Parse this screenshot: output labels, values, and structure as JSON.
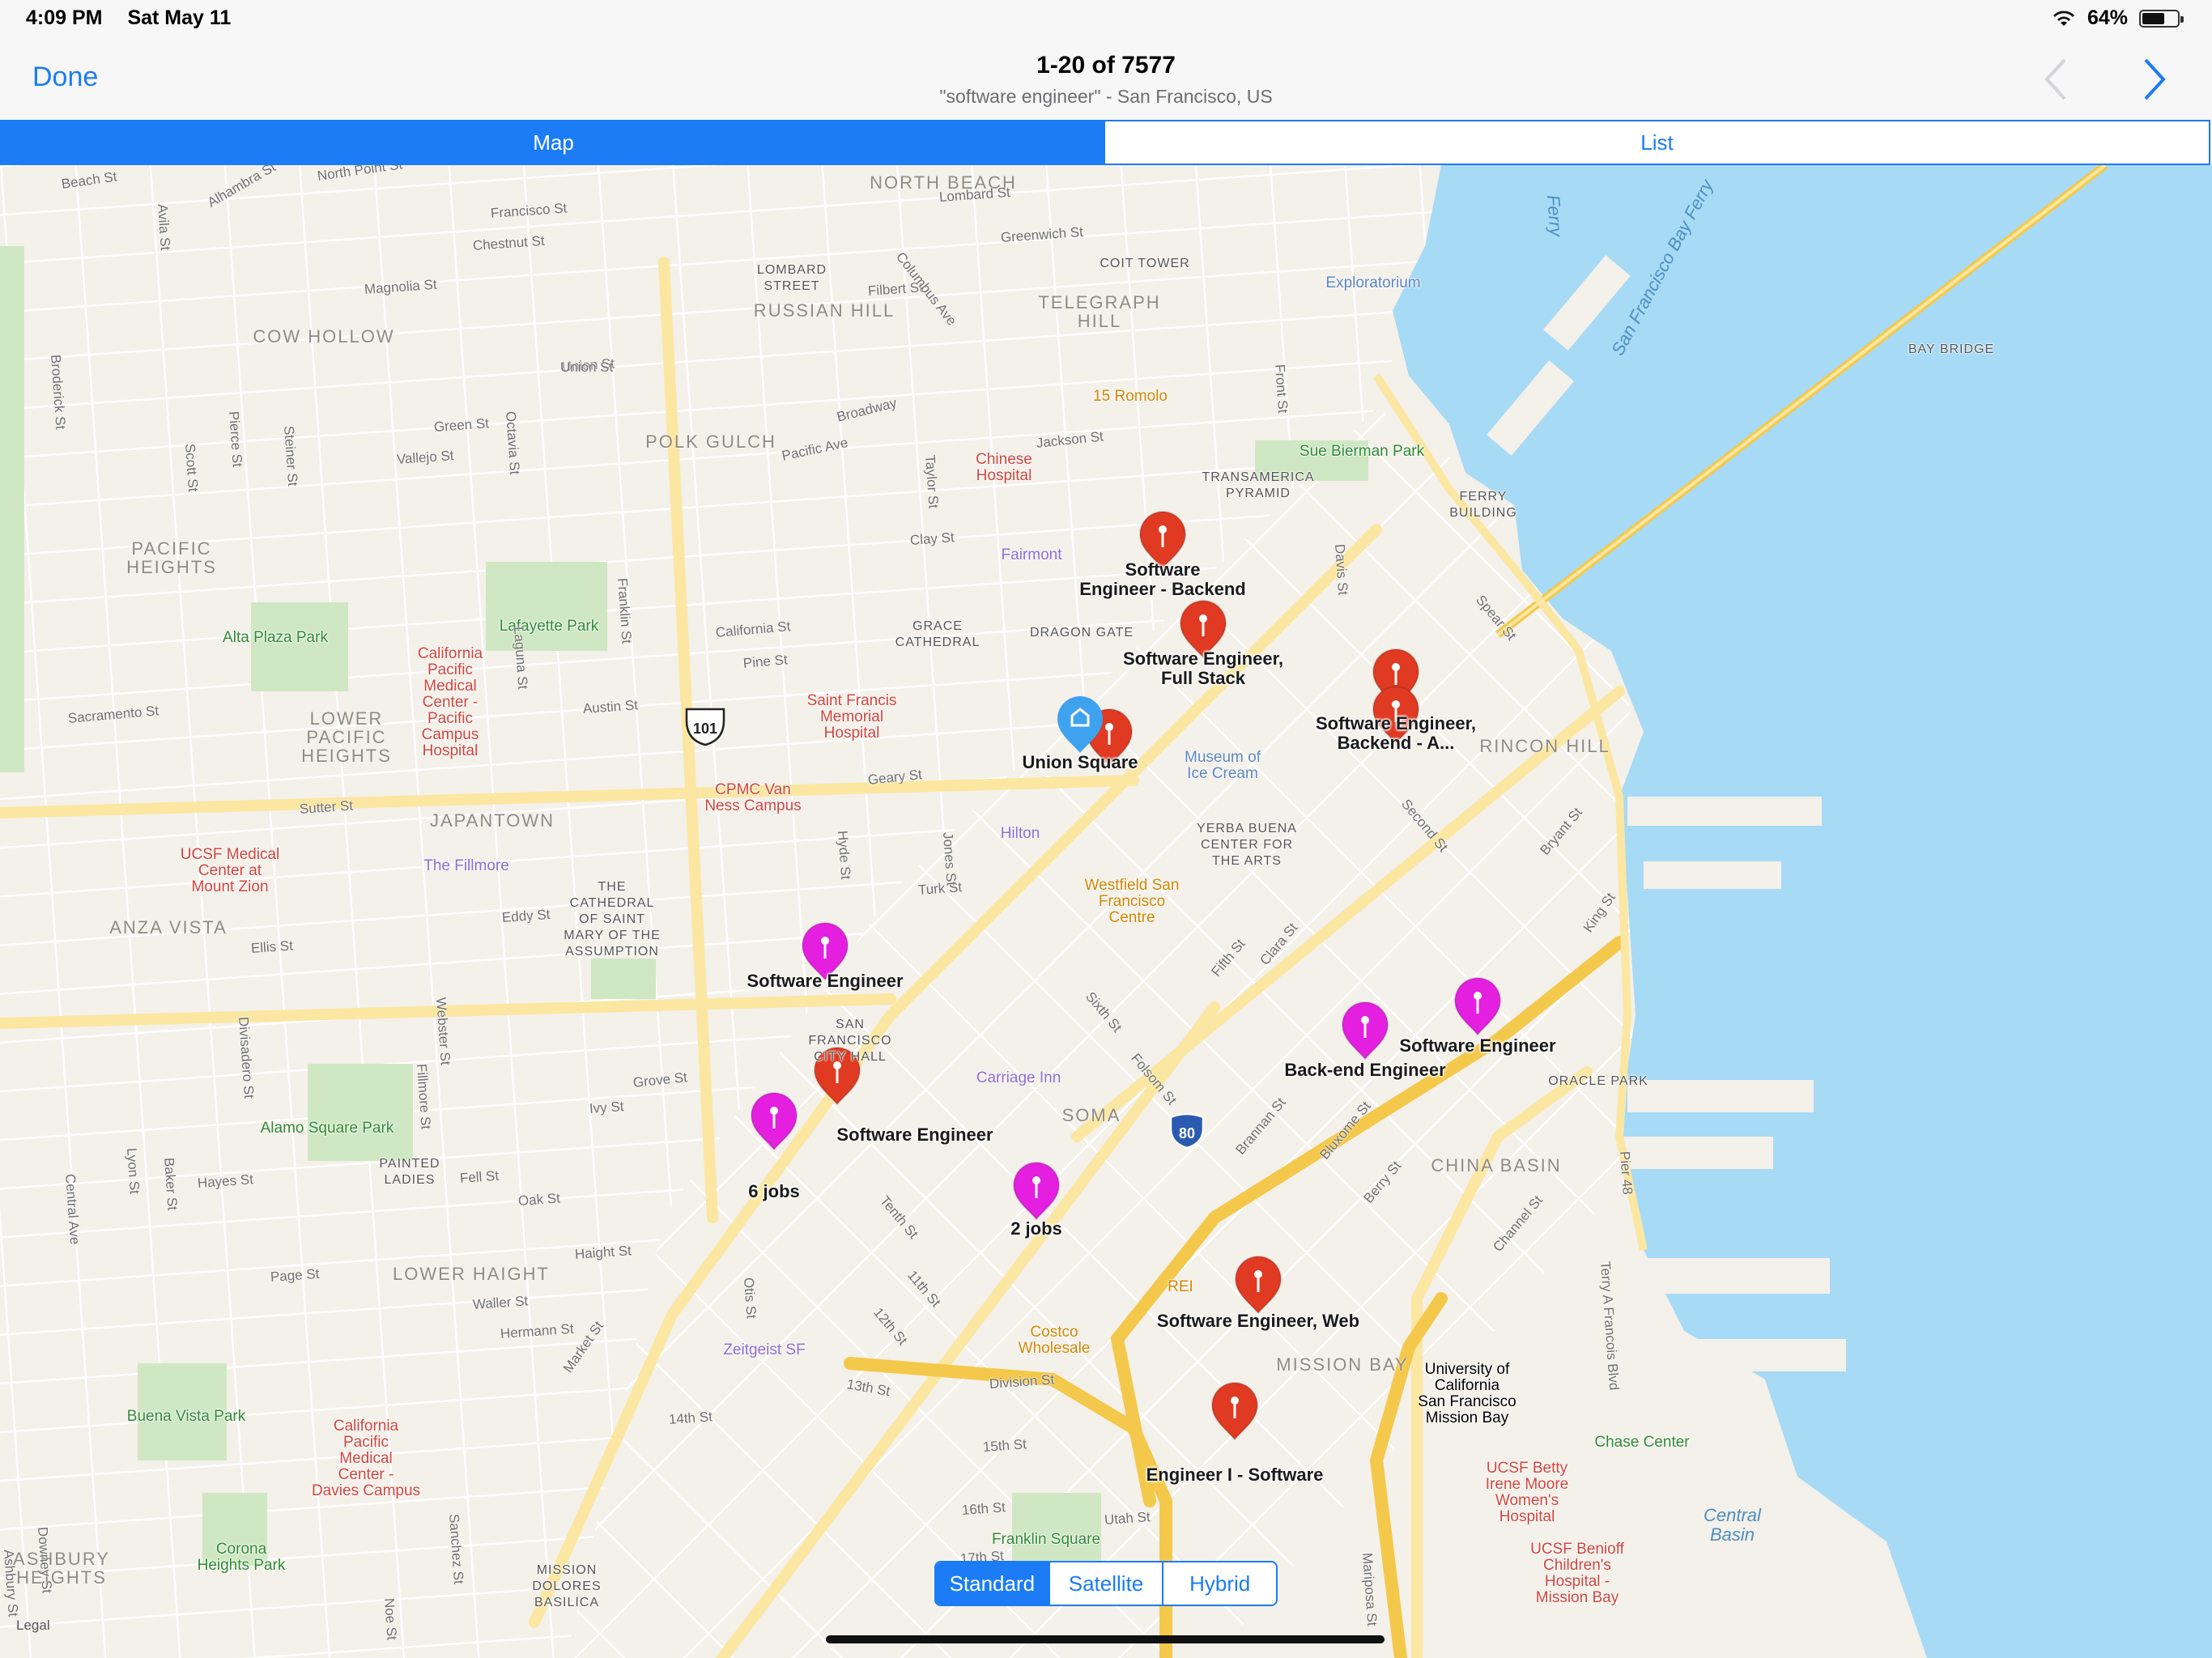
{
  "status": {
    "time": "4:09 PM",
    "date": "Sat May 11",
    "battery": "64%",
    "battery_level": 0.64
  },
  "nav": {
    "done_label": "Done",
    "title": "1-20 of 7577",
    "subtitle": "\"software engineer\" - San Francisco, US"
  },
  "tabs": [
    {
      "label": "Map",
      "active": true
    },
    {
      "label": "List",
      "active": false
    }
  ],
  "map_type": [
    {
      "label": "Standard",
      "active": true
    },
    {
      "label": "Satellite",
      "active": false
    },
    {
      "label": "Hybrid",
      "active": false
    }
  ],
  "legal": "Legal",
  "colors": {
    "accent": "#1b7cf5",
    "pin_red": "#e03a22",
    "pin_magenta": "#e41fe0",
    "water": "#a7daf5",
    "park": "#cfe8c3",
    "road": "#fbe7a1",
    "freeway": "#f4c94b"
  },
  "pins": [
    {
      "color": "red",
      "label": "Software\nEngineer - Backend"
    },
    {
      "color": "red",
      "label": "Software Engineer,\nFull Stack"
    },
    {
      "color": "red",
      "label": ""
    },
    {
      "color": "red",
      "label": "Software Engineer,\nBackend - A..."
    },
    {
      "color": "red",
      "label": ""
    },
    {
      "color": "magenta",
      "label": "Software Engineer"
    },
    {
      "color": "red",
      "label": "Software Engineer"
    },
    {
      "color": "magenta",
      "label": "6 jobs"
    },
    {
      "color": "magenta",
      "label": "2 jobs"
    },
    {
      "color": "magenta",
      "label": "Back-end Engineer"
    },
    {
      "color": "magenta",
      "label": "Software Engineer"
    },
    {
      "color": "red",
      "label": "Software Engineer, Web"
    },
    {
      "color": "red",
      "label": "Engineer I - Software"
    }
  ],
  "user_location_label": "Union Square",
  "districts": [
    "NORTH BEACH",
    "RUSSIAN HILL",
    "TELEGRAPH\nHILL",
    "COW HOLLOW",
    "POLK GULCH",
    "PACIFIC\nHEIGHTS",
    "LOWER\nPACIFIC\nHEIGHTS",
    "JAPANTOWN",
    "ANZA VISTA",
    "RINCON HILL",
    "SOMA",
    "CHINA BASIN",
    "MISSION BAY",
    "LOWER HAIGHT",
    "ASHBURY\nHEIGHTS"
  ],
  "pois": [
    {
      "name": "Lafayette Park",
      "kind": "green"
    },
    {
      "name": "Alta Plaza Park",
      "kind": "green"
    },
    {
      "name": "Alamo Square Park",
      "kind": "green"
    },
    {
      "name": "Buena Vista Park",
      "kind": "green"
    },
    {
      "name": "Corona\nHeights Park",
      "kind": "green"
    },
    {
      "name": "Franklin Square",
      "kind": "green"
    },
    {
      "name": "Sue Bierman Park",
      "kind": "green"
    },
    {
      "name": "Chase Center",
      "kind": "green"
    },
    {
      "name": "California\nPacific\nMedical\nCenter -\nPacific\nCampus\nHospital",
      "kind": "red"
    },
    {
      "name": "Chinese\nHospital",
      "kind": "red"
    },
    {
      "name": "Saint Francis\nMemorial\nHospital",
      "kind": "red"
    },
    {
      "name": "CPMC Van\nNess Campus",
      "kind": "red"
    },
    {
      "name": "UCSF Medical\nCenter at\nMount Zion",
      "kind": "red"
    },
    {
      "name": "California\nPacific\nMedical\nCenter -\nDavies Campus",
      "kind": "red"
    },
    {
      "name": "UCSF Betty\nIrene Moore\nWomen's\nHospital",
      "kind": "red"
    },
    {
      "name": "UCSF Benioff\nChildren's\nHospital -\nMission Bay",
      "kind": "red"
    },
    {
      "name": "15 Romolo",
      "kind": "orange"
    },
    {
      "name": "Westfield San\nFrancisco\nCentre",
      "kind": "orange"
    },
    {
      "name": "Costco\nWholesale",
      "kind": "orange"
    },
    {
      "name": "REI",
      "kind": "orange"
    },
    {
      "name": "Fairmont",
      "kind": "purple"
    },
    {
      "name": "Hilton",
      "kind": "purple"
    },
    {
      "name": "Carriage Inn",
      "kind": "purple"
    },
    {
      "name": "The Fillmore",
      "kind": "purple"
    },
    {
      "name": "Zeitgeist SF",
      "kind": "purple"
    },
    {
      "name": "Museum of\nIce Cream",
      "kind": "blue"
    },
    {
      "name": "Exploratorium",
      "kind": "blue"
    },
    {
      "name": "University of\nCalifornia\nSan Francisco\nMission Bay",
      "kind": "brown"
    },
    {
      "name": "LOMBARD\nSTREET",
      "kind": "dark"
    },
    {
      "name": "COIT TOWER",
      "kind": "dark"
    },
    {
      "name": "TRANSAMERICA\nPYRAMID",
      "kind": "dark"
    },
    {
      "name": "FERRY\nBUILDING",
      "kind": "dark"
    },
    {
      "name": "BAY BRIDGE",
      "kind": "dark"
    },
    {
      "name": "GRACE\nCATHEDRAL",
      "kind": "dark"
    },
    {
      "name": "DRAGON GATE",
      "kind": "dark"
    },
    {
      "name": "YERBA BUENA\nCENTER FOR\nTHE ARTS",
      "kind": "dark"
    },
    {
      "name": "THE\nCATHEDRAL\nOF SAINT\nMARY OF THE\nASSUMPTION",
      "kind": "dark"
    },
    {
      "name": "SAN\nFRANCISCO\nCITY HALL",
      "kind": "dark"
    },
    {
      "name": "PAINTED\nLADIES",
      "kind": "dark"
    },
    {
      "name": "ORACLE PARK",
      "kind": "dark"
    },
    {
      "name": "MISSION\nDOLORES\nBASILICA",
      "kind": "dark"
    }
  ],
  "streets": [
    "Beach St",
    "North Point St",
    "Francisco St",
    "Chestnut St",
    "Lombard St",
    "Greenwich St",
    "Filbert St",
    "Union St",
    "Green St",
    "Vallejo St",
    "Broadway",
    "Pacific Ave",
    "Jackson St",
    "Clay St",
    "California St",
    "Pine St",
    "Sacramento St",
    "Austin St",
    "Sutter St",
    "Geary St",
    "Eddy St",
    "Turk St",
    "Ellis St",
    "Grove St",
    "Ivy St",
    "Hayes St",
    "Fell St",
    "Oak St",
    "Page St",
    "Haight St",
    "Waller St",
    "Hermann St",
    "Market St",
    "Franklin St",
    "Octavia St",
    "Laguna St",
    "Webster St",
    "Fillmore St",
    "Steiner St",
    "Pierce St",
    "Scott St",
    "Divisadero St",
    "Baker St",
    "Lyon St",
    "Central Ave",
    "Hyde St",
    "Jones St",
    "Taylor St",
    "Columbus Ave",
    "Front St",
    "Davis St",
    "Spear St",
    "Second St",
    "Sixth St",
    "Fifth St",
    "Clara St",
    "Folsom St",
    "Bryant St",
    "King St",
    "Brannan St",
    "Bluxome St",
    "Berry St",
    "Channel St",
    "Tenth St",
    "11th St",
    "12th St",
    "13th St",
    "14th St",
    "15th St",
    "16th St",
    "17th St",
    "Division St",
    "Mariposa St",
    "Otis St",
    "Utah St",
    "Terry A Francois Blvd",
    "Pier 48",
    "Alhambra St",
    "Magnolia St",
    "Broderick St",
    "Avila St",
    "Sanchez St",
    "Noe St",
    "Ashbury St",
    "Downey St",
    "Union St"
  ],
  "shields": [
    "101",
    "80"
  ],
  "water_labels": [
    "Central\nBasin",
    "San Francisco Bay Ferry",
    "Ferry"
  ]
}
